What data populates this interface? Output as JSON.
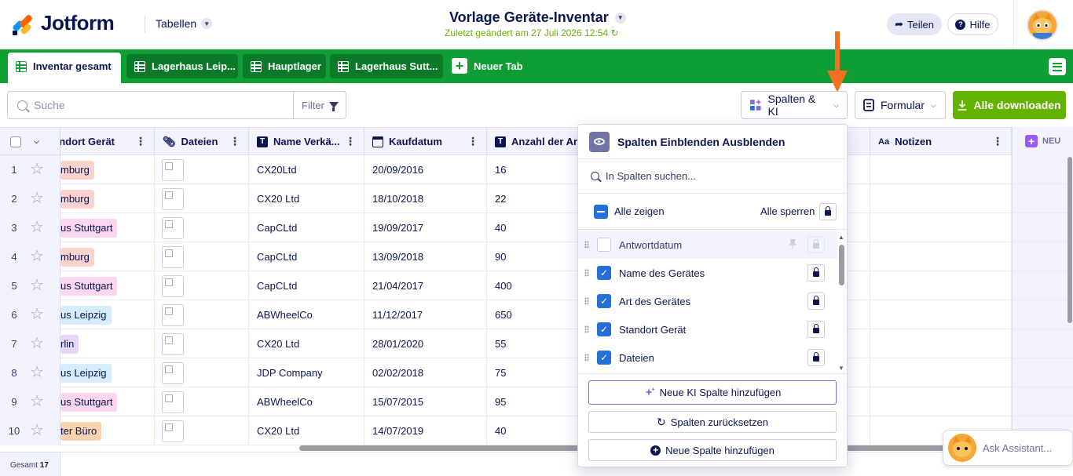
{
  "header": {
    "logo_text": "Jotform",
    "tables_label": "Tabellen",
    "doc_title": "Vorlage Geräte-Inventar",
    "doc_subtitle": "Zuletzt geändert am 27 Juli 2026 12:54",
    "share_label": "Teilen",
    "help_label": "Hilfe"
  },
  "tabs": [
    {
      "label": "Inventar gesamt",
      "active": true
    },
    {
      "label": "Lagerhaus Leip...",
      "active": false
    },
    {
      "label": "Hauptlager",
      "active": false
    },
    {
      "label": "Lagerhaus Sutt...",
      "active": false
    }
  ],
  "new_tab_label": "Neuer Tab",
  "toolbar": {
    "search_placeholder": "Suche",
    "filter_label": "Filter",
    "columns_ai_label": "Spalten & KI",
    "form_label": "Formular",
    "download_label": "Alle downloaden"
  },
  "columns": {
    "standort": "Standort Gerät",
    "dateien": "Dateien",
    "verkaeufer": "Name Verkä...",
    "kaufdatum": "Kaufdatum",
    "anzahl": "Anzahl der Art",
    "notizen": "Notizen",
    "neu": "NEU"
  },
  "rows": [
    {
      "n": "1",
      "standort": "Hamburg",
      "tag_color": "#fcd2cd",
      "verkaeufer": "CX20Ltd",
      "kaufdatum": "20/09/2016",
      "anzahl": "16"
    },
    {
      "n": "2",
      "standort": "Hamburg",
      "tag_color": "#fcd2cd",
      "verkaeufer": "CX20 Ltd",
      "kaufdatum": "18/10/2018",
      "anzahl": "22"
    },
    {
      "n": "3",
      "standort": "Lagerhaus Stuttgart",
      "tag_color": "#fbd6ef",
      "verkaeufer": "CapCLtd",
      "kaufdatum": "19/09/2017",
      "anzahl": "40"
    },
    {
      "n": "4",
      "standort": "Hamburg",
      "tag_color": "#fcd2cd",
      "verkaeufer": "CapCLtd",
      "kaufdatum": "13/09/2018",
      "anzahl": "90"
    },
    {
      "n": "5",
      "standort": "Lagerhaus Stuttgart",
      "tag_color": "#fbd6ef",
      "verkaeufer": "CapCLtd",
      "kaufdatum": "21/04/2017",
      "anzahl": "400"
    },
    {
      "n": "6",
      "standort": "Lagerhaus Leipzig",
      "tag_color": "#d4ecfb",
      "verkaeufer": "ABWheelCo",
      "kaufdatum": "11/12/2017",
      "anzahl": "650"
    },
    {
      "n": "7",
      "standort": "Berlin",
      "tag_color": "#e7d6f8",
      "verkaeufer": "CX20 Ltd",
      "kaufdatum": "28/01/2020",
      "anzahl": "55"
    },
    {
      "n": "8",
      "standort": "Lagerhaus Leipzig",
      "tag_color": "#d4ecfb",
      "verkaeufer": "JDP Company",
      "kaufdatum": "02/02/2018",
      "anzahl": "75"
    },
    {
      "n": "9",
      "standort": "Lagerhaus Stuttgart",
      "tag_color": "#fbd6ef",
      "verkaeufer": "ABWheelCo",
      "kaufdatum": "15/07/2015",
      "anzahl": "95"
    },
    {
      "n": "10",
      "standort": "Hinter Büro",
      "tag_color": "#fbd3b0",
      "verkaeufer": "CX20 Ltd",
      "kaufdatum": "14/07/2019",
      "anzahl": "40"
    }
  ],
  "tag_texts_visible": [
    "mburg",
    "mburg",
    "us Stuttgart",
    "mburg",
    "us Stuttgart",
    "us Leipzig",
    "rlin",
    "us Leipzig",
    "us Stuttgart",
    "ter Büro"
  ],
  "footer": {
    "total_label": "Gesamt",
    "total_count": "17"
  },
  "panel": {
    "title": "Spalten Einblenden Ausblenden",
    "search_placeholder": "In Spalten suchen...",
    "show_all_label": "Alle zeigen",
    "lock_all_label": "Alle sperren",
    "items": [
      {
        "label": "Antwortdatum",
        "checked": false,
        "disabled": true
      },
      {
        "label": "Name des Gerätes",
        "checked": true,
        "disabled": false
      },
      {
        "label": "Art des Gerätes",
        "checked": true,
        "disabled": false
      },
      {
        "label": "Standort Gerät",
        "checked": true,
        "disabled": false
      },
      {
        "label": "Dateien",
        "checked": true,
        "disabled": false
      }
    ],
    "add_ai_label": "Neue KI Spalte hinzufügen",
    "reset_label": "Spalten zurücksetzen",
    "add_column_label": "Neue Spalte hinzufügen"
  },
  "assistant_label": "Ask Assistant...",
  "colors": {
    "brand_green": "#0e9e34",
    "download_green": "#64b200",
    "accent_blue": "#2470d8",
    "orange_arrow": "#f36f21"
  }
}
